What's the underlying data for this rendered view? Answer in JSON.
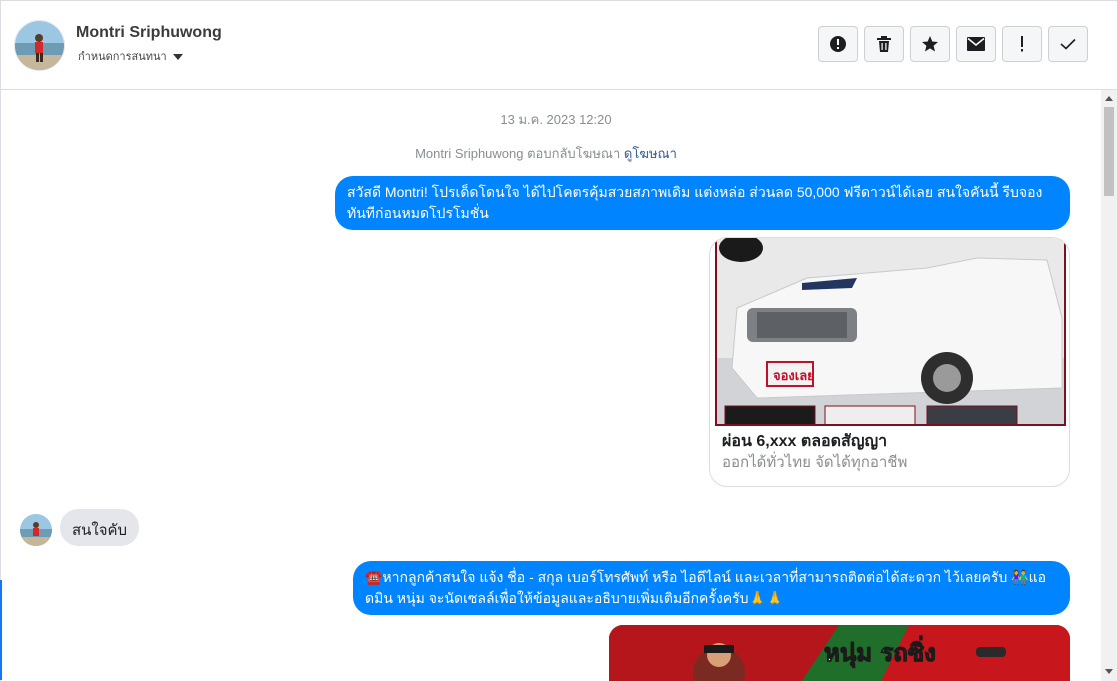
{
  "header": {
    "contact_name": "Montri Sriphuwong",
    "assign_label": "กำหนดการสนทนา",
    "toolbar": [
      {
        "name": "spam-button",
        "icon": "alert-circle-icon"
      },
      {
        "name": "delete-button",
        "icon": "trash-icon"
      },
      {
        "name": "star-button",
        "icon": "star-icon"
      },
      {
        "name": "mark-unread-button",
        "icon": "envelope-icon"
      },
      {
        "name": "follow-up-button",
        "icon": "exclamation-icon"
      },
      {
        "name": "mark-done-button",
        "icon": "checkmark-icon"
      }
    ]
  },
  "thread": {
    "timestamp": "13 ม.ค. 2023 12:20",
    "ad_reply": {
      "text": "Montri Sriphuwong ตอบกลับโฆษณา",
      "link": "ดูโฆษณา"
    },
    "messages": [
      {
        "direction": "out",
        "text": "สวัสดี Montri! โปรเด็ดโดนใจ ได้ไปโคตรคุ้มสวยสภาพเดิม แต่งหล่อ  ส่วนลด 50,000 ฟรีดาวน์ได้เลย  สนใจคันนี้ รีบจองทันทีก่อนหมดโปรโมชั่น"
      },
      {
        "direction": "out",
        "type": "ad-card",
        "image_text": "จองเลย",
        "title": "ผ่อน 6,xxx ตลอดสัญญา",
        "subtitle": "ออกได้ทั่วไทย จัดได้ทุกอาชีพ"
      },
      {
        "direction": "in",
        "text": "สนใจคับ"
      },
      {
        "direction": "out",
        "text": "☎️หากลูกค้าสนใจ แจ้ง ชื่อ - สกุล เบอร์โทรศัพท์ หรือ ไอดีไลน์ และเวลาที่สามารถติดต่อได้สะดวก ไว้เลยครับ 👫แอดมิน หนุ่ม จะนัดเซลล์เพื่อให้ข้อมูลและอธิบายเพิ่มเติมอีกครั้งครับ🙏🙏"
      },
      {
        "direction": "out",
        "type": "image",
        "banner_text": "หนุ่ม รถซิ่ง"
      }
    ]
  },
  "colors": {
    "outgoing_bubble": "#0084ff",
    "incoming_bubble": "#e4e6eb",
    "link": "#385898",
    "banner_red": "#c81e1e"
  }
}
